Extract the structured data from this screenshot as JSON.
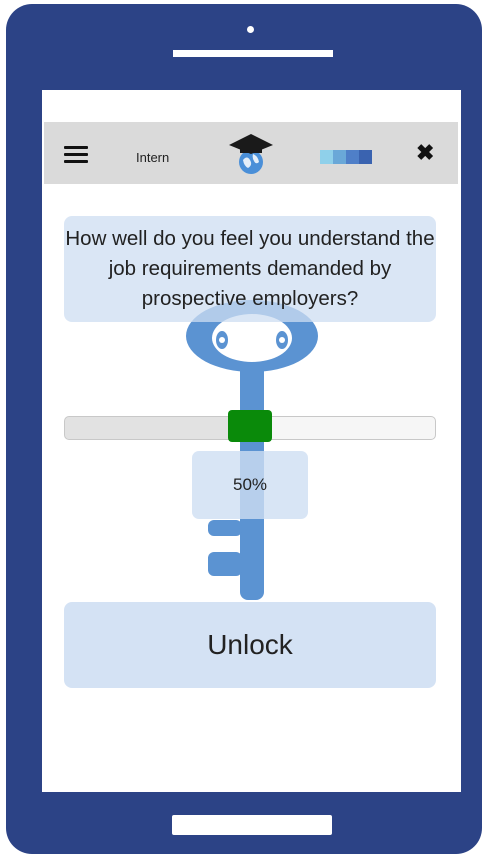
{
  "header": {
    "title": "Intern",
    "progress_colors": [
      "#8fd0ea",
      "#6aa8d8",
      "#4f7fc8",
      "#3a63b0"
    ]
  },
  "question": {
    "text": "How well do you feel you understand the job requirements demanded by prospective employers?"
  },
  "slider": {
    "value": 0.5,
    "label": "50%"
  },
  "actions": {
    "unlock_label": "Unlock"
  },
  "icons": {
    "menu": "hamburger-menu-icon",
    "logo": "graduation-cap-globe-icon",
    "progress": "progress-blocks-icon",
    "close": "close-icon",
    "background": "key-icon"
  },
  "colors": {
    "phone_frame": "#2c4386",
    "topbar": "#dadada",
    "card": "#cedef2",
    "slider_thumb": "#0a8a0a",
    "key": "#5b93d2"
  }
}
